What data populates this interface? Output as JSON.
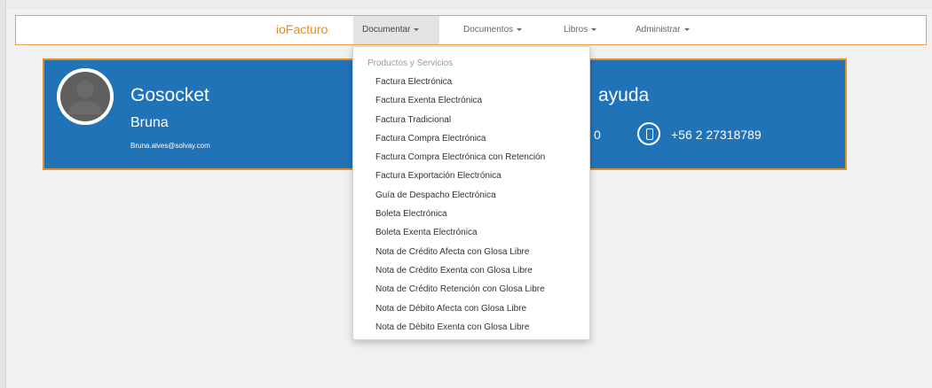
{
  "navbar": {
    "brand": "ioFacturo",
    "items": [
      {
        "label": "Documentar"
      },
      {
        "label": "Documentos"
      },
      {
        "label": "Libros"
      },
      {
        "label": "Administrar"
      }
    ]
  },
  "banner": {
    "company": "Gosocket",
    "user_name": "Bruna",
    "user_email": "Bruna.alves@solvay.com",
    "help_title": "ayuda",
    "help_partial_text": "0",
    "phone_number": "+56 2 27318789"
  },
  "dropdown": {
    "header": "Productos y Servicios",
    "items": [
      "Factura Electrónica",
      "Factura Exenta Electrónica",
      "Factura Tradicional",
      "Factura Compra Electrónica",
      "Factura Compra Electrónica con Retención",
      "Factura Exportación Electrónica",
      "Guía de Despacho Electrónica",
      "Boleta Electrónica",
      "Boleta Exenta Electrónica",
      "Nota de Crédito Afecta con Glosa Libre",
      "Nota de Crédito Exenta con Glosa Libre",
      "Nota de Crédito Retención con Glosa Libre",
      "Nota de Débito Afecta con Glosa Libre",
      "Nota de Débito Exenta con Glosa Libre"
    ]
  },
  "colors": {
    "brand": "#f08a12",
    "banner_bg": "#2173b8",
    "banner_border": "#e28d2a",
    "navbar_border": "#f0a04a"
  }
}
